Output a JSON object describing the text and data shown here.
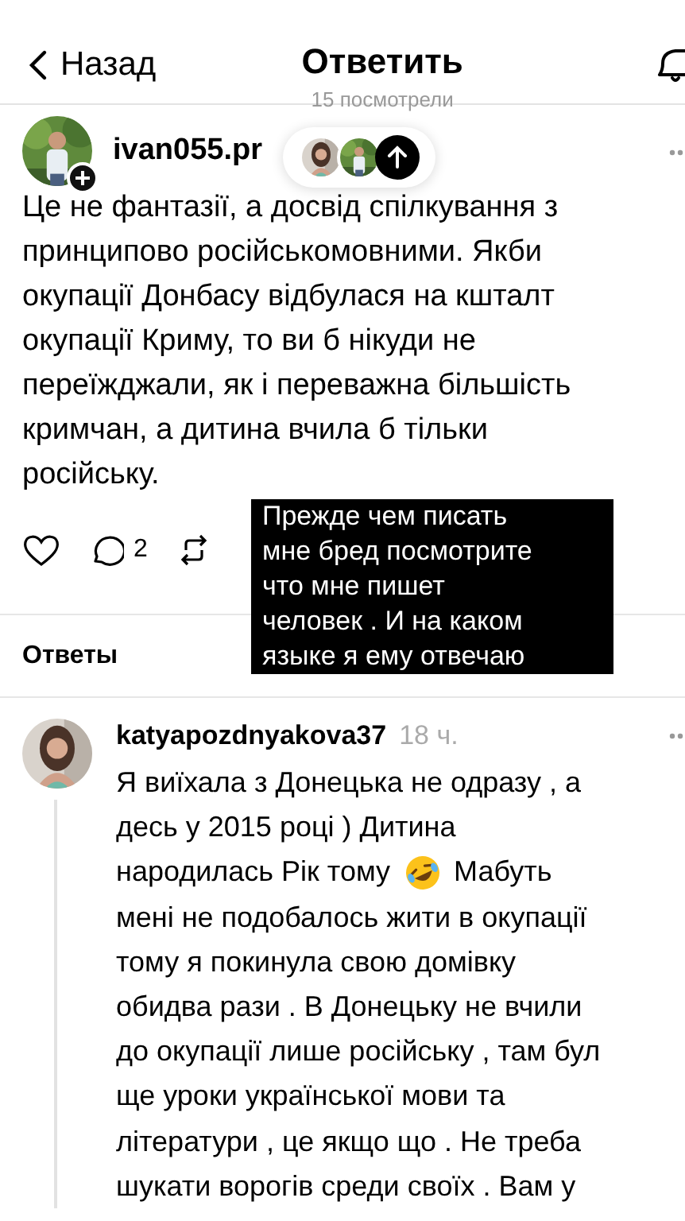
{
  "header": {
    "back": "Назад",
    "title": "Ответить",
    "subtitle": "15 посмотрели"
  },
  "post": {
    "username": "ivan055.pr",
    "text_lines": [
      "Це не фантазії, а досвід спілкування з",
      "принципово російськомовними. Якби",
      "окупації Донбасу відбулася на кшталт",
      "окупації Криму, то ви б нікуди не",
      "переїжджали, як і переважна більшість",
      "кримчан, а дитина вчила б тільки",
      "російську."
    ],
    "comments": "2"
  },
  "overlay_caption": [
    "Прежде чем писать",
    "мне бред посмотрите",
    "что мне пишет",
    "человек . И на каком",
    "языке я ему отвечаю"
  ],
  "replies_label": "Ответы",
  "reply": {
    "username": "katyapozdnyakova37",
    "time": "18 ч.",
    "lines": [
      {
        "parts": [
          "Я виїхала з Донецька не одразу , а"
        ]
      },
      {
        "parts": [
          "десь у 2015 році )  Дитина"
        ]
      },
      {
        "parts": [
          "народилась  Рік тому",
          "Мабуть"
        ]
      },
      {
        "parts": [
          "мені не подобалось жити в окупації"
        ]
      },
      {
        "parts": [
          "тому я покинула свою домівку"
        ]
      },
      {
        "parts": [
          "обидва рази .  В Донецьку не вчили"
        ]
      },
      {
        "parts": [
          "до окупації лише російську , там бул"
        ]
      },
      {
        "parts": [
          "ще уроки української мови та"
        ]
      },
      {
        "parts": [
          "літератури , це якщо що .  Не треба"
        ]
      },
      {
        "parts": [
          "шукати ворогів среди своїх . Вам у"
        ]
      }
    ]
  }
}
